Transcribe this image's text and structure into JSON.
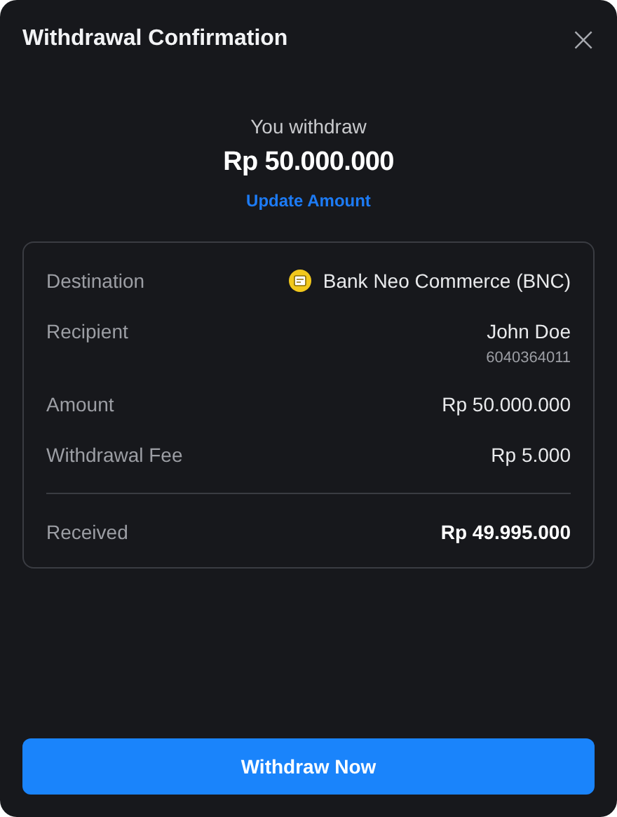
{
  "dialog": {
    "title": "Withdrawal Confirmation",
    "close": "×"
  },
  "summary": {
    "label": "You withdraw",
    "amount": "Rp 50.000.000",
    "link": "Update Amount"
  },
  "details": [
    {
      "kind": "bank",
      "label": "Destination",
      "value": "Bank Neo Commerce (BNC)"
    },
    {
      "kind": "account",
      "label": "Recipient",
      "value": "John Doe",
      "sub": "6040364011"
    },
    {
      "kind": "plain",
      "label": "Amount",
      "value": "Rp 50.000.000"
    },
    {
      "kind": "plain",
      "label": "Withdrawal Fee",
      "value": "Rp 5.000"
    }
  ],
  "total": {
    "label": "Received",
    "value": "Rp 49.995.000"
  },
  "button": "Withdraw Now"
}
